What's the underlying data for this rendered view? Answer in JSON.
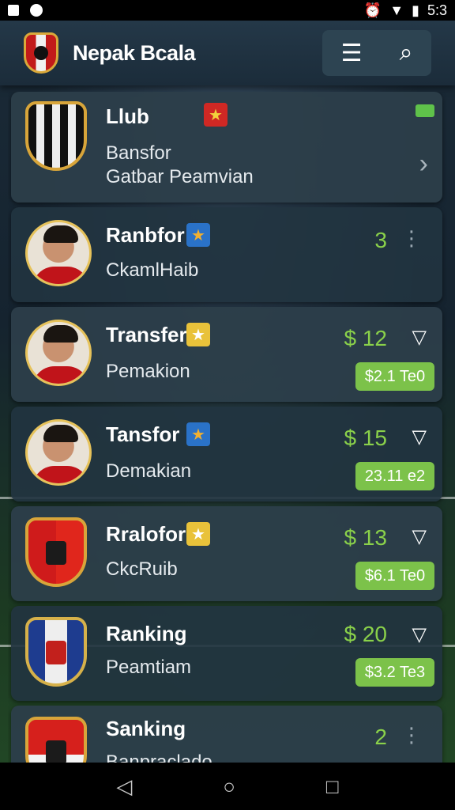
{
  "status_bar": {
    "time": "5:3"
  },
  "app": {
    "title": "Nepak Bcala"
  },
  "list": [
    {
      "name": "Llub",
      "line1": "Bansfor",
      "line2": "Gatbar Peamvian"
    },
    {
      "name": "Ranbfor",
      "sub": "CkamlHaib",
      "rank": "3"
    },
    {
      "name": "Transfer",
      "sub": "Pemakion",
      "price": "$ 12",
      "pill": "$2.1 Te0"
    },
    {
      "name": "Tansfor",
      "sub": "Demakian",
      "price": "$ 15",
      "pill": "23.11 e2"
    },
    {
      "name": "Rralofor",
      "sub": "CkcRuib",
      "price": "$ 13",
      "pill": "$6.1 Te0"
    },
    {
      "name": "Ranking",
      "sub": "Peamtiam",
      "price": "$ 20",
      "pill": "$3.2 Te3"
    },
    {
      "name": "Sanking",
      "sub": "Banpraclado",
      "rank": "2"
    }
  ],
  "icons": {
    "menu": "list-icon",
    "search": "search-icon",
    "back": "back-icon",
    "home": "home-icon",
    "recent": "recent-apps-icon"
  }
}
